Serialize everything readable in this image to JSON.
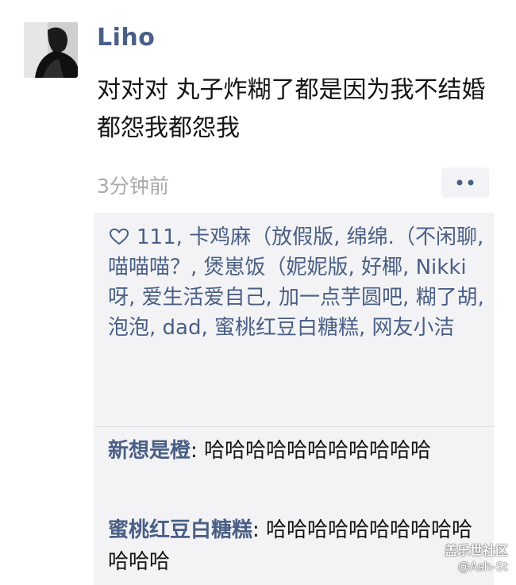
{
  "post": {
    "username": "Liho",
    "content": "对对对 丸子炸糊了都是因为我不结婚 都怨我都怨我",
    "timestamp": "3分钟前",
    "more_label": "••"
  },
  "likes": {
    "icon": "heart-outline-icon",
    "text": "111, 卡鸡麻（放假版, 绵绵.（不闲聊, 喵喵喵？, 煲崽饭（妮妮版, 好椰, Nikki呀, 爱生活爱自己, 加一点芋圆吧, 糊了胡, 泡泡, dad, 蜜桃红豆白糖糕, 网友小洁"
  },
  "comments": [
    {
      "author": "新想是橙",
      "separator": ": ",
      "text": "哈哈哈哈哈哈哈哈哈哈哈"
    },
    {
      "author": "蜜桃红豆白糖糕",
      "separator": ": ",
      "text": "哈哈哈哈哈哈哈哈哈哈哈哈哈"
    }
  ],
  "watermark": {
    "brand": "盖乐世社区",
    "handle": "@Ash-St"
  },
  "colors": {
    "author_blue": "#4a5f86",
    "panel_bg": "#f3f3f5",
    "timestamp_gray": "#aaaaaa"
  }
}
